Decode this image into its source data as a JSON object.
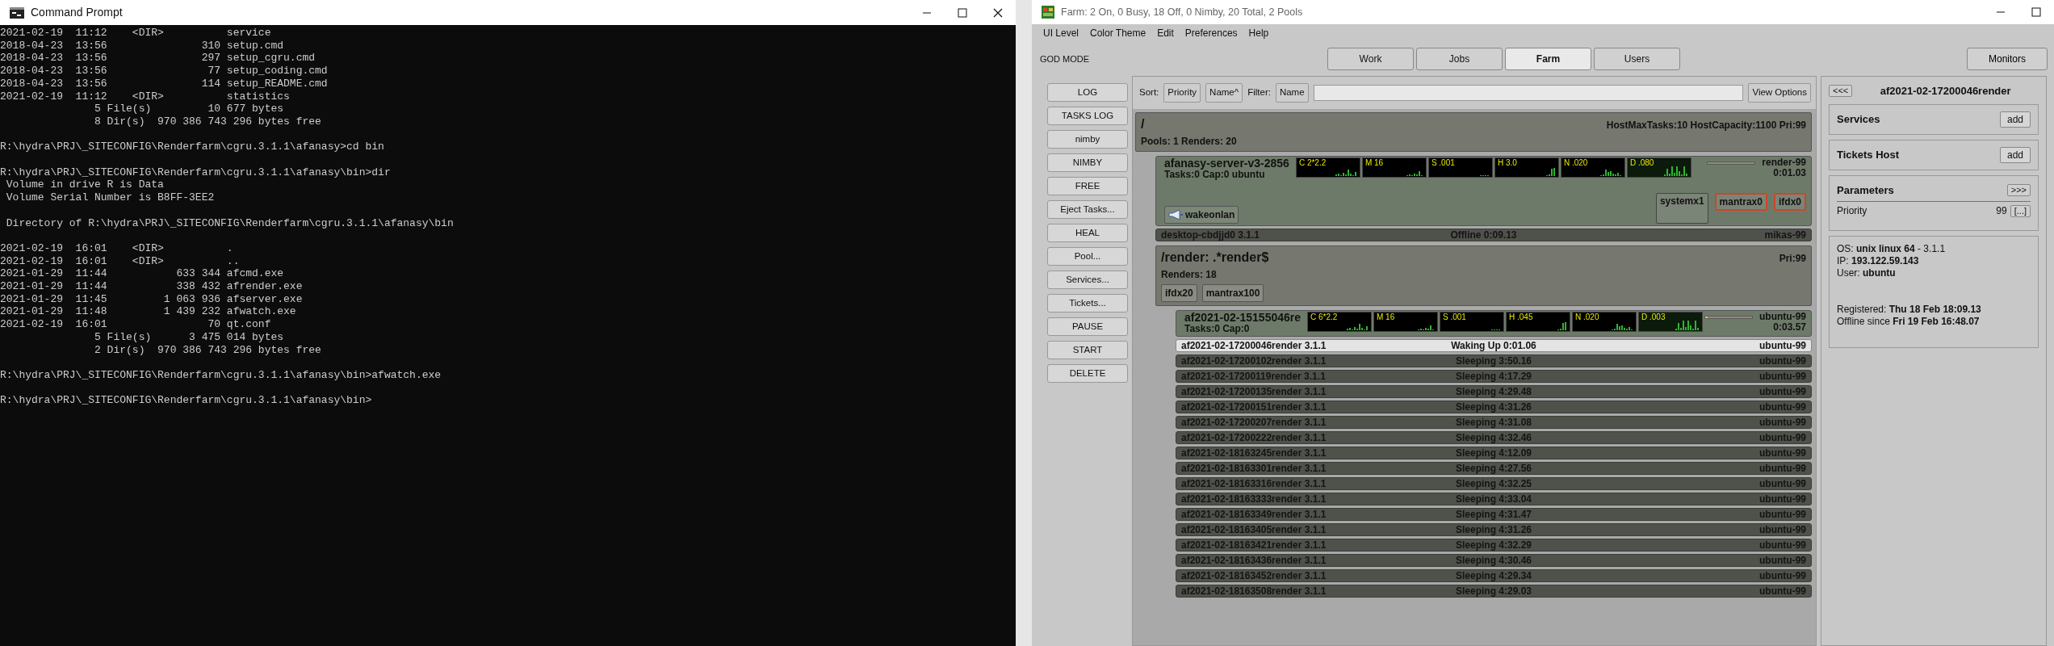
{
  "terminal": {
    "title": "Command Prompt",
    "blocks": [
      [
        "2021-02-19  11:12    <DIR>          service",
        "2018-04-23  13:56               310 setup.cmd",
        "2018-04-23  13:56               297 setup_cgru.cmd",
        "2018-04-23  13:56                77 setup_coding.cmd",
        "2018-04-23  13:56               114 setup_README.cmd",
        "2021-02-19  11:12    <DIR>          statistics",
        "               5 File(s)         10 677 bytes",
        "               8 Dir(s)  970 386 743 296 bytes free"
      ],
      [
        "R:\\hydra\\PRJ\\_SITECONFIG\\Renderfarm\\cgru.3.1.1\\afanasy>cd bin"
      ],
      [
        "R:\\hydra\\PRJ\\_SITECONFIG\\Renderfarm\\cgru.3.1.1\\afanasy\\bin>dir",
        " Volume in drive R is Data",
        " Volume Serial Number is B8FF-3EE2"
      ],
      [
        " Directory of R:\\hydra\\PRJ\\_SITECONFIG\\Renderfarm\\cgru.3.1.1\\afanasy\\bin"
      ],
      [
        "2021-02-19  16:01    <DIR>          .",
        "2021-02-19  16:01    <DIR>          ..",
        "2021-01-29  11:44           633 344 afcmd.exe",
        "2021-01-29  11:44           338 432 afrender.exe",
        "2021-01-29  11:45         1 063 936 afserver.exe",
        "2021-01-29  11:48         1 439 232 afwatch.exe",
        "2021-02-19  16:01                70 qt.conf",
        "               5 File(s)      3 475 014 bytes",
        "               2 Dir(s)  970 386 743 296 bytes free"
      ],
      [
        "R:\\hydra\\PRJ\\_SITECONFIG\\Renderfarm\\cgru.3.1.1\\afanasy\\bin>afwatch.exe"
      ],
      [
        "R:\\hydra\\PRJ\\_SITECONFIG\\Renderfarm\\cgru.3.1.1\\afanasy\\bin>"
      ]
    ]
  },
  "farm": {
    "title": "Farm: 2 On, 0 Busy, 18 Off, 0 Nimby, 20 Total, 2 Pools",
    "menu": [
      "UI Level",
      "Color Theme",
      "Edit",
      "Preferences",
      "Help"
    ],
    "mode_label": "GOD MODE",
    "tabs": [
      {
        "label": "Work",
        "selected": false
      },
      {
        "label": "Jobs",
        "selected": false
      },
      {
        "label": "Farm",
        "selected": true
      },
      {
        "label": "Users",
        "selected": false
      }
    ],
    "monitors_button": "Monitors",
    "actions": [
      "LOG",
      "TASKS LOG",
      "nimby",
      "NIMBY",
      "FREE",
      "Eject Tasks...",
      "HEAL",
      "Pool...",
      "Services...",
      "Tickets...",
      "PAUSE",
      "START",
      "DELETE"
    ],
    "sort_bar": {
      "sort_label": "Sort:",
      "sort_buttons": [
        "Priority",
        "Name^"
      ],
      "filter_label": "Filter:",
      "filter_button": "Name",
      "view_options": "View Options"
    },
    "pools": [
      {
        "kind": "pool",
        "name": "/",
        "info": "HostMaxTasks:10 HostCapacity:1100 Pri:99",
        "stats": "Pools: 1 Renders: 20",
        "children": [
          {
            "kind": "host",
            "name": "afanasy-server-v3-2856",
            "tasks": "Tasks:0 Cap:0 ubuntu",
            "graphs": [
              "C 2*2.2",
              "M 16",
              "S .001",
              "H 3.0",
              "N .020",
              "D .080"
            ],
            "user": "render-99",
            "time": "0:01.03",
            "services": [
              "wakeonlan"
            ],
            "tickets": [
              {
                "label": "systemx1",
                "alert": false
              },
              {
                "label": "mantrax0",
                "alert": true
              },
              {
                "label": "ifdx0",
                "alert": true
              }
            ]
          },
          {
            "kind": "row",
            "name": "desktop-cbdjjd0 3.1.1",
            "state": "Offline 0:09.13",
            "user": "mikas-99",
            "selected": false
          },
          {
            "kind": "pool",
            "name": "/render: .*render$",
            "info": "Pri:99",
            "stats": "Renders: 18",
            "tags": [
              "ifdx20",
              "mantrax100"
            ],
            "children": [
              {
                "kind": "host",
                "name": "af2021-02-15155046re",
                "tasks": "Tasks:0 Cap:0",
                "graphs": [
                  "C 6*2.2",
                  "M 16",
                  "S .001",
                  "H .045",
                  "N .020",
                  "D .003"
                ],
                "level": 0.06,
                "user": "ubuntu-99",
                "time": "0:03.57"
              },
              {
                "kind": "row",
                "name": "af2021-02-17200046render 3.1.1",
                "state": "Waking Up 0:01.06",
                "user": "ubuntu-99",
                "selected": true
              },
              {
                "kind": "row",
                "name": "af2021-02-17200102render 3.1.1",
                "state": "Sleeping 3:50.16",
                "user": "ubuntu-99",
                "selected": false
              },
              {
                "kind": "row",
                "name": "af2021-02-17200119render 3.1.1",
                "state": "Sleeping 4:17.29",
                "user": "ubuntu-99",
                "selected": false
              },
              {
                "kind": "row",
                "name": "af2021-02-17200135render 3.1.1",
                "state": "Sleeping 4:29.48",
                "user": "ubuntu-99",
                "selected": false
              },
              {
                "kind": "row",
                "name": "af2021-02-17200151render 3.1.1",
                "state": "Sleeping 4:31.26",
                "user": "ubuntu-99",
                "selected": false
              },
              {
                "kind": "row",
                "name": "af2021-02-17200207render 3.1.1",
                "state": "Sleeping 4:31.08",
                "user": "ubuntu-99",
                "selected": false
              },
              {
                "kind": "row",
                "name": "af2021-02-17200222render 3.1.1",
                "state": "Sleeping 4:32.46",
                "user": "ubuntu-99",
                "selected": false
              },
              {
                "kind": "row",
                "name": "af2021-02-18163245render 3.1.1",
                "state": "Sleeping 4:12.09",
                "user": "ubuntu-99",
                "selected": false
              },
              {
                "kind": "row",
                "name": "af2021-02-18163301render 3.1.1",
                "state": "Sleeping 4:27.56",
                "user": "ubuntu-99",
                "selected": false
              },
              {
                "kind": "row",
                "name": "af2021-02-18163316render 3.1.1",
                "state": "Sleeping 4:32.25",
                "user": "ubuntu-99",
                "selected": false
              },
              {
                "kind": "row",
                "name": "af2021-02-18163333render 3.1.1",
                "state": "Sleeping 4:33.04",
                "user": "ubuntu-99",
                "selected": false
              },
              {
                "kind": "row",
                "name": "af2021-02-18163349render 3.1.1",
                "state": "Sleeping 4:31.47",
                "user": "ubuntu-99",
                "selected": false
              },
              {
                "kind": "row",
                "name": "af2021-02-18163405render 3.1.1",
                "state": "Sleeping 4:31.26",
                "user": "ubuntu-99",
                "selected": false
              },
              {
                "kind": "row",
                "name": "af2021-02-18163421render 3.1.1",
                "state": "Sleeping 4:32.29",
                "user": "ubuntu-99",
                "selected": false
              },
              {
                "kind": "row",
                "name": "af2021-02-18163436render 3.1.1",
                "state": "Sleeping 4:30.46",
                "user": "ubuntu-99",
                "selected": false
              },
              {
                "kind": "row",
                "name": "af2021-02-18163452render 3.1.1",
                "state": "Sleeping 4:29.34",
                "user": "ubuntu-99",
                "selected": false
              },
              {
                "kind": "row",
                "name": "af2021-02-18163508render 3.1.1",
                "state": "Sleeping 4:29.03",
                "user": "ubuntu-99",
                "selected": false
              }
            ]
          }
        ]
      }
    ],
    "details": {
      "back_button": "<<<",
      "title": "af2021-02-17200046render",
      "sections": [
        {
          "title": "Services",
          "button": "add"
        },
        {
          "title": "Tickets Host",
          "button": "add"
        }
      ],
      "parameters": {
        "title": "Parameters",
        "expand_button": ">>>",
        "rows": [
          {
            "label": "Priority",
            "value": "99",
            "button": "[...]"
          }
        ]
      },
      "info_groups": [
        [
          "OS: **unix linux 64** - 3.1.1",
          "IP: **193.122.59.143**",
          "User: **ubuntu**"
        ],
        [
          "Registered: **Thu 18 Feb 18:09.13**",
          "Offline since **Fri 19 Feb 16:48.07**"
        ]
      ]
    }
  }
}
